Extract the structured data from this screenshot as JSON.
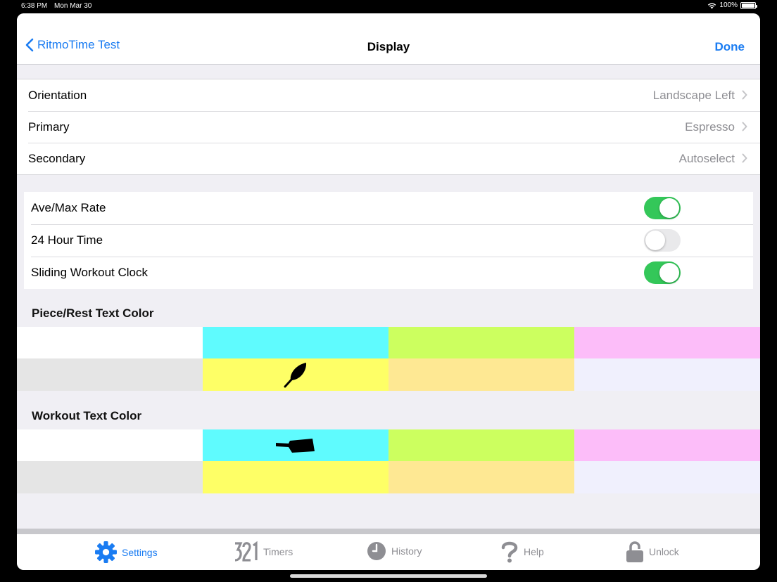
{
  "status_bar": {
    "time": "6:38 PM",
    "date": "Mon Mar 30",
    "battery": "100%"
  },
  "nav": {
    "back_label": "RitmoTime Test",
    "title": "Display",
    "done_label": "Done"
  },
  "settings": [
    {
      "label": "Orientation",
      "value": "Landscape Left"
    },
    {
      "label": "Primary",
      "value": "Espresso"
    },
    {
      "label": "Secondary",
      "value": "Autoselect"
    }
  ],
  "toggles": [
    {
      "label": "Ave/Max Rate",
      "on": true
    },
    {
      "label": "24 Hour Time",
      "on": false
    },
    {
      "label": "Sliding Workout Clock",
      "on": true
    }
  ],
  "piece_rest": {
    "title": "Piece/Rest Text Color",
    "colors": [
      "#ffffff",
      "#5ffbfe",
      "#ccff5f",
      "#fcbdf9",
      "#e5e5e5",
      "#feff66",
      "#fee893",
      "#f0f0fd"
    ],
    "selected_index": 5,
    "selected_icon": "feather-icon"
  },
  "workout": {
    "title": "Workout Text Color",
    "colors": [
      "#ffffff",
      "#5ffbfe",
      "#ccff5f",
      "#fcbdf9",
      "#e5e5e5",
      "#feff66",
      "#fee893",
      "#f0f0fd"
    ],
    "selected_index": 1,
    "selected_icon": "oar-blade-icon"
  },
  "tabs": [
    {
      "label": "Settings",
      "icon": "gear-icon",
      "active": true
    },
    {
      "label": "Timers",
      "icon": "countdown-321-icon",
      "active": false
    },
    {
      "label": "History",
      "icon": "clock-icon",
      "active": false
    },
    {
      "label": "Help",
      "icon": "question-icon",
      "active": false
    },
    {
      "label": "Unlock",
      "icon": "lock-icon",
      "active": false
    }
  ],
  "colors": {
    "accent": "#1a7cf2",
    "switch_on": "#34c759",
    "switch_off": "#e9e9eb",
    "background": "#f0eff4"
  }
}
